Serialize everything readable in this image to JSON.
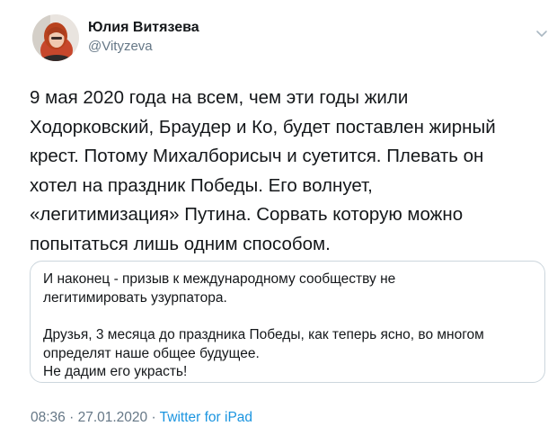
{
  "author": {
    "name": "Юлия Витязева",
    "handle": "@Vityzeva"
  },
  "tweet": {
    "lines": [
      "9 мая 2020 года на всем, чем эти годы жили",
      "Ходорковский, Браудер и Ко, будет поставлен жирный",
      "крест. Потому Михалборисыч и суетится. Плевать он",
      "хотел на праздник Победы. Его волнует,",
      "«легитимизация» Путина. Сорвать которую можно",
      "попытаться лишь одним способом."
    ]
  },
  "quote": {
    "paragraph1": [
      "И наконец - призыв к международному сообществу не",
      "легитимировать узурпатора."
    ],
    "paragraph2": [
      "Друзья, 3 месяца до праздника Победы, как теперь ясно, во многом",
      "определят наше общее будущее.",
      "Не дадим его украсть!"
    ]
  },
  "meta": {
    "time": "08:36",
    "separator1": " · ",
    "date": "27.01.2020",
    "separator2": " · ",
    "source": "Twitter for iPad"
  },
  "icons": {
    "menu": "chevron-down-icon",
    "avatar": "avatar"
  },
  "colors": {
    "text": "#14171a",
    "secondary": "#657786",
    "link": "#1b95e0",
    "border": "#ccd6dd"
  }
}
